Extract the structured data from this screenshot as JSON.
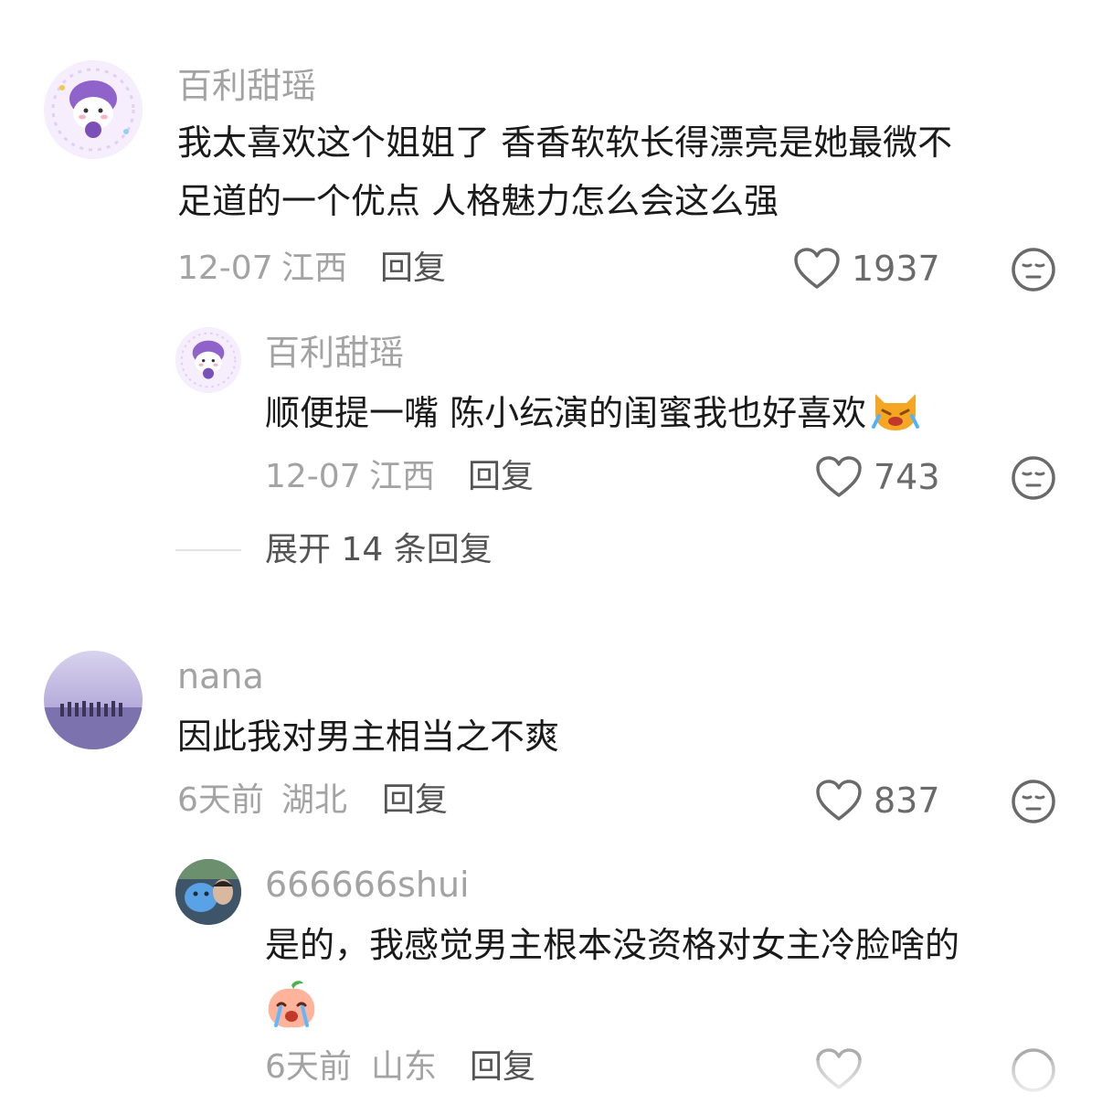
{
  "comments": [
    {
      "username": "百利甜瑶",
      "text_lines": [
        "我太喜欢这个姐姐了 香香软软长得漂亮是她最微不",
        "足道的一个优点 人格魅力怎么会这么强"
      ],
      "date": "12-07",
      "location": "江西",
      "reply_label": "回复",
      "likes": "1937",
      "avatar_icon": "purple-cat-avatar",
      "replies": [
        {
          "username": "百利甜瑶",
          "text": "顺便提一嘴 陈小纭演的闺蜜我也好喜欢",
          "emoji": "crying-cat-emoji",
          "date": "12-07",
          "location": "江西",
          "reply_label": "回复",
          "likes": "743",
          "avatar_icon": "purple-cat-avatar"
        }
      ],
      "expand_label": "展开 14 条回复"
    },
    {
      "username": "nana",
      "text_lines": [
        "因此我对男主相当之不爽"
      ],
      "date": "6天前",
      "location": "湖北",
      "reply_label": "回复",
      "likes": "837",
      "avatar_icon": "beach-sunset-avatar",
      "replies": [
        {
          "username": "666666shui",
          "text": "是的，我感觉男主根本没资格对女主冷脸啥的",
          "emoji": "crying-peach-emoji",
          "date": "6天前",
          "location": "山东",
          "reply_label": "回复",
          "avatar_icon": "blue-plush-avatar"
        }
      ]
    }
  ],
  "colors": {
    "text": "#1a1a1a",
    "muted": "#a3a3a3",
    "reply": "#545454",
    "icon": "#6a6a6a"
  }
}
